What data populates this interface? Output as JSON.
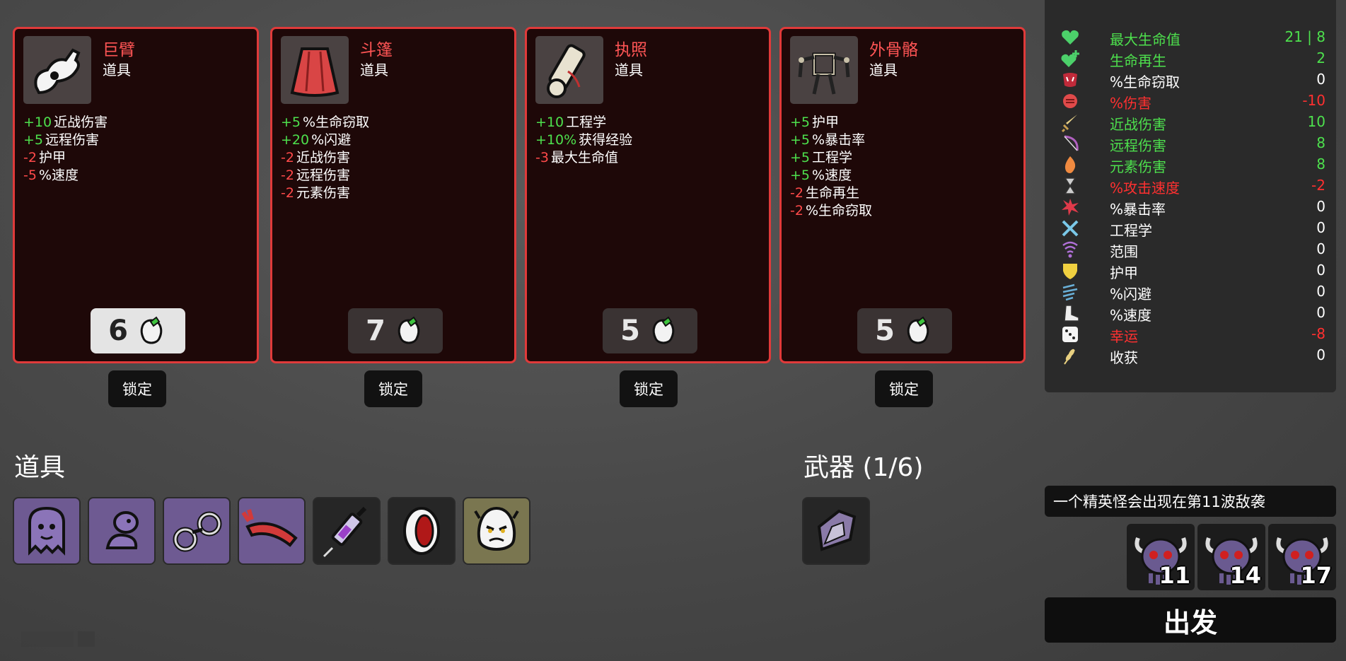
{
  "shop": {
    "cards": [
      {
        "name": "巨臂",
        "type": "道具",
        "price": "6",
        "stats": [
          {
            "num": "+10",
            "text": "近战伤害",
            "sign": "pos"
          },
          {
            "num": "+5",
            "text": "远程伤害",
            "sign": "pos"
          },
          {
            "num": "-2",
            "text": "护甲",
            "sign": "neg"
          },
          {
            "num": "-5",
            "text": "%速度",
            "sign": "neg"
          }
        ]
      },
      {
        "name": "斗篷",
        "type": "道具",
        "price": "7",
        "stats": [
          {
            "num": "+5",
            "text": "%生命窃取",
            "sign": "pos"
          },
          {
            "num": "+20",
            "text": "%闪避",
            "sign": "pos"
          },
          {
            "num": "-2",
            "text": "近战伤害",
            "sign": "neg"
          },
          {
            "num": "-2",
            "text": "远程伤害",
            "sign": "neg"
          },
          {
            "num": "-2",
            "text": "元素伤害",
            "sign": "neg"
          }
        ]
      },
      {
        "name": "执照",
        "type": "道具",
        "price": "5",
        "stats": [
          {
            "num": "+10",
            "text": "工程学",
            "sign": "pos"
          },
          {
            "num": "+10%",
            "text": "获得经验",
            "sign": "pos"
          },
          {
            "num": "-3",
            "text": "最大生命值",
            "sign": "neg"
          }
        ]
      },
      {
        "name": "外骨骼",
        "type": "道具",
        "price": "5",
        "stats": [
          {
            "num": "+5",
            "text": "护甲",
            "sign": "pos"
          },
          {
            "num": "+5",
            "text": "%暴击率",
            "sign": "pos"
          },
          {
            "num": "+5",
            "text": "工程学",
            "sign": "pos"
          },
          {
            "num": "+5",
            "text": "%速度",
            "sign": "pos"
          },
          {
            "num": "-2",
            "text": "生命再生",
            "sign": "neg"
          },
          {
            "num": "-2",
            "text": "%生命窃取",
            "sign": "neg"
          }
        ]
      }
    ],
    "lock_label": "锁定"
  },
  "inventory": {
    "items_title": "道具",
    "weapons_title": "武器 (1/6)"
  },
  "player_stats": [
    {
      "icon": "heart-icon",
      "label": "最大生命值",
      "value": "21 | 8",
      "color": "green"
    },
    {
      "icon": "regen-heart-icon",
      "label": "生命再生",
      "value": "2",
      "color": "green"
    },
    {
      "icon": "lifesteal-icon",
      "label": "%生命窃取",
      "value": "0",
      "color": "white"
    },
    {
      "icon": "damage-fist-icon",
      "label": "%伤害",
      "value": "-10",
      "color": "red"
    },
    {
      "icon": "sword-icon",
      "label": "近战伤害",
      "value": "10",
      "color": "green"
    },
    {
      "icon": "bow-icon",
      "label": "远程伤害",
      "value": "8",
      "color": "green"
    },
    {
      "icon": "flame-icon",
      "label": "元素伤害",
      "value": "8",
      "color": "green"
    },
    {
      "icon": "hourglass-icon",
      "label": "%攻击速度",
      "value": "-2",
      "color": "red"
    },
    {
      "icon": "crit-burst-icon",
      "label": "%暴击率",
      "value": "0",
      "color": "white"
    },
    {
      "icon": "wrench-cross-icon",
      "label": "工程学",
      "value": "0",
      "color": "white"
    },
    {
      "icon": "range-signal-icon",
      "label": "范围",
      "value": "0",
      "color": "white"
    },
    {
      "icon": "shield-icon",
      "label": "护甲",
      "value": "0",
      "color": "white"
    },
    {
      "icon": "wind-dodge-icon",
      "label": "%闪避",
      "value": "0",
      "color": "white"
    },
    {
      "icon": "boot-icon",
      "label": "%速度",
      "value": "0",
      "color": "white"
    },
    {
      "icon": "dice-icon",
      "label": "幸运",
      "value": "-8",
      "color": "red"
    },
    {
      "icon": "wheat-icon",
      "label": "收获",
      "value": "0",
      "color": "white"
    }
  ],
  "waves": {
    "message": "一个精英怪会出现在第11波敌袭",
    "numbers": [
      "11",
      "14",
      "17"
    ]
  },
  "go_label": "出发"
}
